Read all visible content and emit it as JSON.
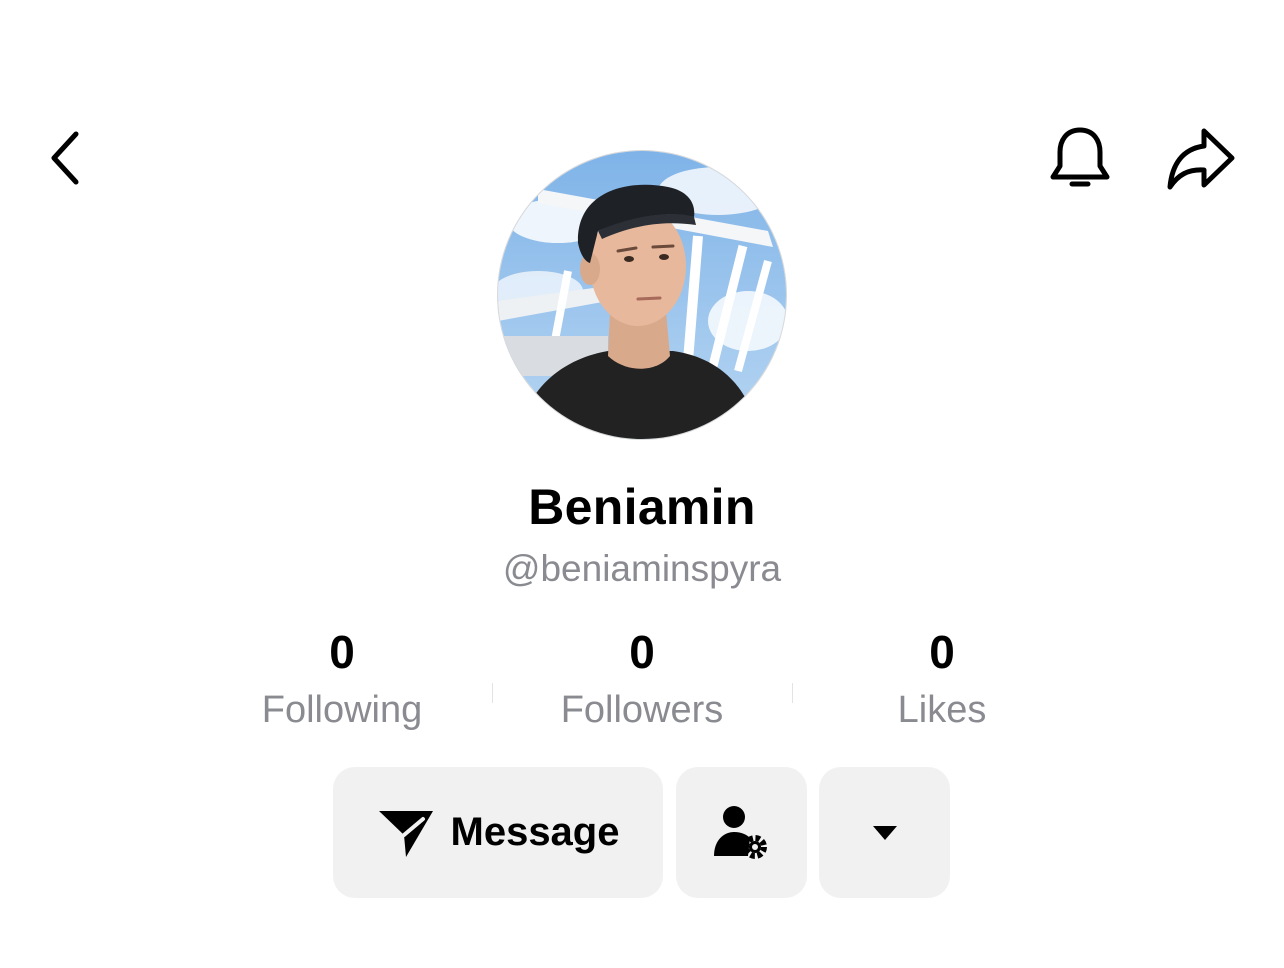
{
  "header": {
    "back_icon": "chevron-left-icon",
    "notification_icon": "bell-icon",
    "share_icon": "share-arrow-icon"
  },
  "profile": {
    "display_name": "Beniamin",
    "username": "@beniaminspyra"
  },
  "stats": [
    {
      "count": "0",
      "label": "Following"
    },
    {
      "count": "0",
      "label": "Followers"
    },
    {
      "count": "0",
      "label": "Likes"
    }
  ],
  "actions": {
    "message_label": "Message",
    "message_icon": "send-icon",
    "friends_icon": "user-settings-icon",
    "more_icon": "caret-down-icon"
  },
  "colors": {
    "text_primary": "#000000",
    "text_secondary": "#8a8b91",
    "button_background": "#f1f1f2"
  }
}
